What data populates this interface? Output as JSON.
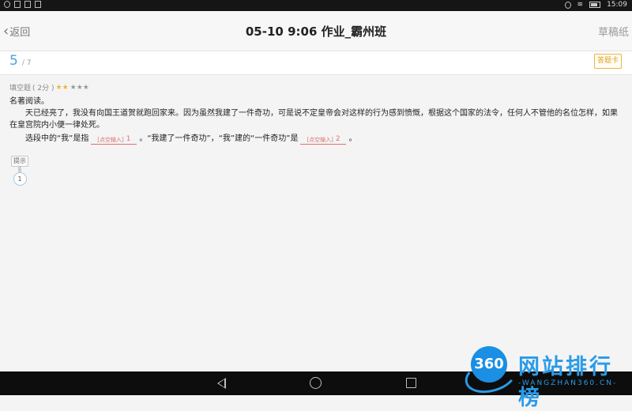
{
  "status_bar": {
    "time": "15:09"
  },
  "nav": {
    "back_label": "返回",
    "title": "05-10 9:06 作业_霸州班",
    "draft_label": "草稿纸"
  },
  "progress": {
    "current": "5",
    "total": "/ 7",
    "answer_card_label": "答题卡"
  },
  "question": {
    "type_label": "填空题",
    "score_label": "( 2分 )",
    "stars_on": "★★",
    "stars_off": "★★★",
    "title": "名著阅读。",
    "passage": "天已经亮了，我没有向国王道贺就跑回家来。因为虽然我建了一件奇功，可是说不定皇帝会对这样的行为感到愤慨，根据这个国家的法令，任何人不管他的名位怎样，如果在皇宫院内小便一律处死。",
    "fill_part1": "选段中的“我”是指",
    "fill_part2": "。“我建了一件奇功”，“我”建的“一件奇功”是",
    "fill_part3": "。",
    "blank_placeholder": "[点空输入]",
    "blank1_num": "1",
    "blank2_num": "2"
  },
  "hint": {
    "label": "提示",
    "number": "1"
  },
  "watermark": {
    "text": "网站排行榜",
    "logo": "360",
    "url": "-WANGZHAN360.CN-"
  }
}
